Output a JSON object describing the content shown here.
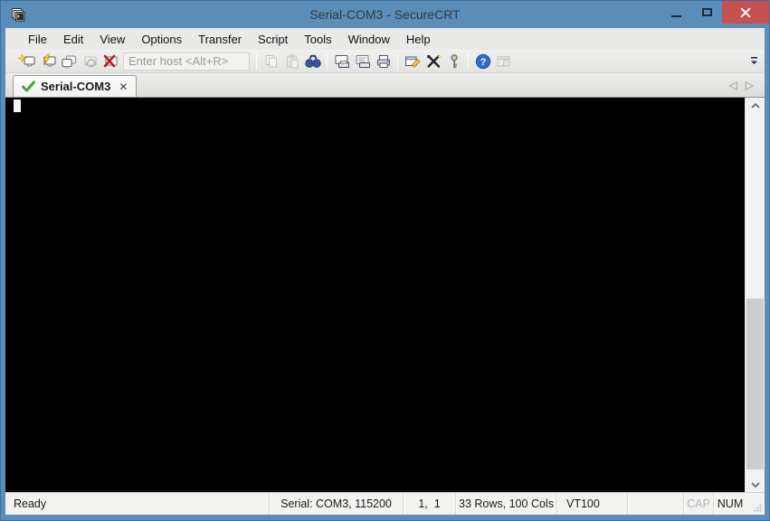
{
  "window": {
    "title": "Serial-COM3 - SecureCRT"
  },
  "menu": {
    "items": [
      "File",
      "Edit",
      "View",
      "Options",
      "Transfer",
      "Script",
      "Tools",
      "Window",
      "Help"
    ]
  },
  "toolbar": {
    "host_placeholder": "Enter host <Alt+R>",
    "host_value": "",
    "icons": [
      "quick-connect",
      "connect",
      "connect-in-tab",
      "reconnect",
      "disconnect",
      "copy",
      "paste",
      "find",
      "print-screen",
      "auto-print",
      "print",
      "session-options",
      "global-options",
      "keymap-editor",
      "help",
      "tile-windows",
      "toolbar-overflow"
    ]
  },
  "tabbar": {
    "active_tab": "Serial-COM3",
    "close_glyph": "✕",
    "scroll_left_glyph": "◁",
    "scroll_right_glyph": "▷"
  },
  "terminal": {
    "content": ""
  },
  "statusbar": {
    "ready": "Ready",
    "serial_info": "Serial: COM3, 115200",
    "cursor_pos": "1,  1",
    "grid_size": "33 Rows, 100 Cols",
    "emulation": "VT100",
    "caps_indicator": "CAP",
    "num_indicator": "NUM"
  },
  "colors": {
    "titlebar_blue": "#5B8DBA",
    "close_red": "#C75050",
    "terminal_bg": "#000000",
    "cursor_white": "#F5F5F5",
    "tab_check_green": "#3FA73F"
  }
}
